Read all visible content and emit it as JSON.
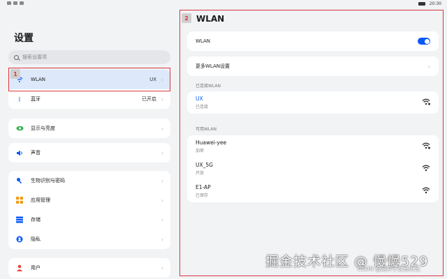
{
  "status": {
    "time": "20:30"
  },
  "left": {
    "title": "设置",
    "search_placeholder": "搜索设置项",
    "annotation": "1",
    "items": [
      {
        "label": "WLAN",
        "value": "UX",
        "icon": "wifi-icon"
      },
      {
        "label": "蓝牙",
        "value": "已开启",
        "icon": "bluetooth-icon"
      },
      {
        "label": "显示与亮度",
        "icon": "eye-icon"
      },
      {
        "label": "声音",
        "icon": "speaker-icon"
      },
      {
        "label": "生物识别与密码",
        "icon": "key-icon"
      },
      {
        "label": "应用管理",
        "icon": "apps-icon"
      },
      {
        "label": "存储",
        "icon": "storage-icon"
      },
      {
        "label": "隐私",
        "icon": "privacy-icon"
      },
      {
        "label": "用户",
        "icon": "user-icon"
      }
    ]
  },
  "right": {
    "annotation": "2",
    "title": "WLAN",
    "wlan_label": "WLAN",
    "wlan_enabled": true,
    "more_settings": "更多WLAN设置",
    "connected_label": "已连接WLAN",
    "connected": {
      "name": "UX",
      "status": "已连接"
    },
    "available_label": "可用WLAN",
    "available": [
      {
        "name": "Huawei-yee",
        "status": "加密"
      },
      {
        "name": "UX_5G",
        "status": "开放"
      },
      {
        "name": "E1-AP",
        "status": "已保存"
      }
    ]
  },
  "watermark": {
    "main": "掘金技术社区 @ 慢慢529",
    "sub": "CSDN @是弃子总会历光"
  },
  "colors": {
    "accent": "#0a59f7",
    "annotation": "#d9363e",
    "selected_row": "#dde9fb"
  }
}
